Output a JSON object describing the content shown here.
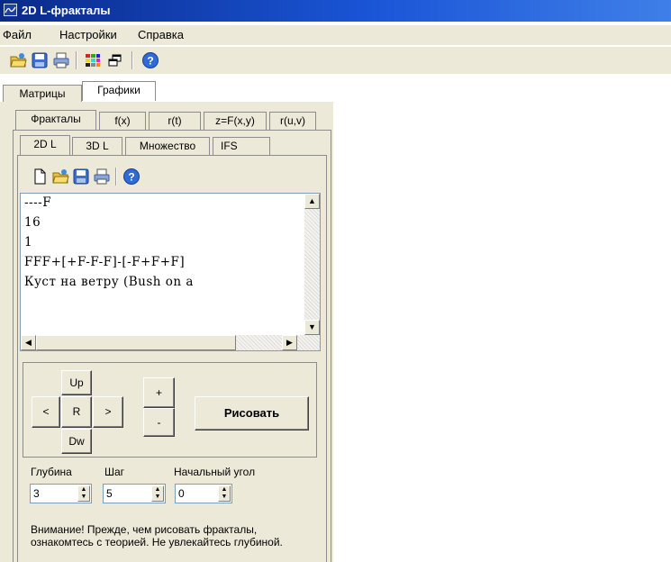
{
  "window": {
    "title": "2D L-фракталы"
  },
  "menu": {
    "items": [
      "Файл",
      "Настройки",
      "Справка"
    ]
  },
  "toolbar": {
    "icons": [
      "open-icon",
      "save-icon",
      "print-icon",
      "palette-icon",
      "window-icon",
      "help-icon"
    ]
  },
  "top_tabs": {
    "items": [
      "Матрицы",
      "Графики"
    ],
    "active": "Графики"
  },
  "sub_tabs": {
    "items": [
      "Фракталы",
      "f(x)",
      "r(t)",
      "z=F(x,y)",
      "r(u,v)"
    ],
    "active": "Фракталы"
  },
  "l_tabs": {
    "items": [
      "2D L",
      "3D L",
      "Множество",
      "IFS"
    ],
    "active": "2D L"
  },
  "editor": {
    "lines": [
      "----F",
      "16",
      "1",
      "FFF+[+F-F-F]-[-F+F+F]",
      "Куст на ветру (Bush on a"
    ]
  },
  "nav": {
    "up": "Up",
    "left": "<",
    "center": "R",
    "right": ">",
    "down": "Dw"
  },
  "zoom": {
    "plus": "+",
    "minus": "-"
  },
  "draw_button": "Рисовать",
  "params": {
    "depth_label": "Глубина",
    "depth_value": "3",
    "step_label": "Шаг",
    "step_value": "5",
    "angle_label": "Начальный угол",
    "angle_value": "0"
  },
  "warning": "Внимание! Прежде, чем рисовать фракталы, ознакомтесь с теорией. Не увлекайтесь глубиной."
}
